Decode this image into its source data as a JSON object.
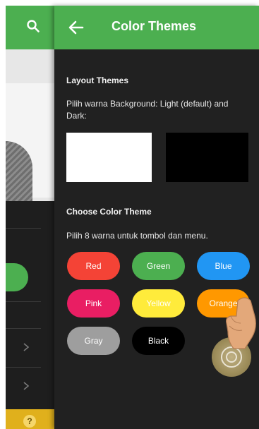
{
  "drawer": {
    "title": "Color Themes",
    "layout_section": {
      "title": "Layout Themes",
      "description": "Pilih warna Background: Light (default) and Dark:",
      "options": [
        {
          "name": "light",
          "color": "#ffffff"
        },
        {
          "name": "dark",
          "color": "#000000"
        }
      ]
    },
    "color_section": {
      "title": "Choose Color Theme",
      "description": "Pilih 8 warna untuk tombol dan menu.",
      "buttons": [
        {
          "label": "Red",
          "color": "#f44336"
        },
        {
          "label": "Green",
          "color": "#4caf50"
        },
        {
          "label": "Blue",
          "color": "#2196f3"
        },
        {
          "label": "Pink",
          "color": "#e91e63"
        },
        {
          "label": "Yellow",
          "color": "#ffeb3b"
        },
        {
          "label": "Orange",
          "color": "#ff9800"
        },
        {
          "label": "Gray",
          "color": "#9e9e9e"
        },
        {
          "label": "Black",
          "color": "#000000"
        }
      ]
    }
  },
  "background_app": {
    "help_glyph": "?",
    "accent": "#4caf50",
    "footer_color": "#e0b01c"
  },
  "icons": {
    "back": "arrow-left-icon",
    "search": "search-icon",
    "chevron": "chevron-right-icon",
    "help": "help-icon",
    "tap": "tap-gesture-icon"
  }
}
